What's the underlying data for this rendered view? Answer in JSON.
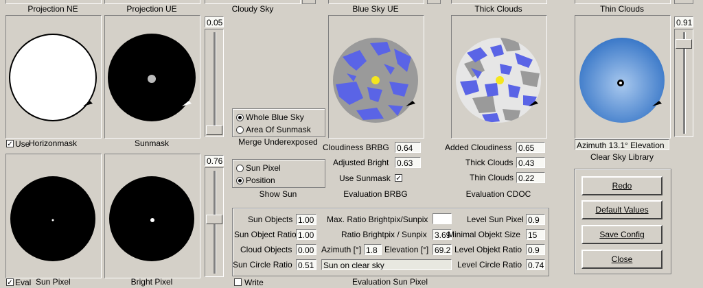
{
  "top_labels": [
    "Projection NE",
    "Projection UE",
    "Cloudy Sky",
    "Blue Sky UE",
    "Thick Clouds",
    "Thin Clouds"
  ],
  "captions": {
    "horizonmask": "Horizonmask",
    "sunmask": "Sunmask",
    "sun_pixel": "Sun Pixel",
    "bright_pixel": "Bright Pixel",
    "clear_sky_library": "Clear Sky Library",
    "azimuth_readout": "Azimuth 13.1°  Elevation"
  },
  "checks": {
    "use": {
      "label": "Use",
      "checked": true
    },
    "eval": {
      "label": "Eval",
      "checked": true
    },
    "write": {
      "label": "Write",
      "checked": false
    },
    "use_sunmask": {
      "label": "Use Sunmask",
      "checked": true
    }
  },
  "sliders": {
    "top_value": "0.05",
    "mid_value": "0.76",
    "right_value": "0.91"
  },
  "merge_group": {
    "options": [
      "Whole Blue Sky",
      "Area Of Sunmask"
    ],
    "selected": "Whole Blue Sky",
    "caption": "Merge Underexposed"
  },
  "sun_group": {
    "options": [
      "Sun Pixel",
      "Position"
    ],
    "selected": "Position",
    "caption": "Show Sun"
  },
  "eval_brbg": {
    "caption": "Evaluation BRBG",
    "fields": [
      {
        "label": "Cloudiness BRBG",
        "value": "0.64"
      },
      {
        "label": "Adjusted Bright",
        "value": "0.63"
      }
    ]
  },
  "eval_cdoc": {
    "caption": "Evaluation CDOC",
    "fields": [
      {
        "label": "Added Cloudiness",
        "value": "0.65"
      },
      {
        "label": "Thick Clouds",
        "value": "0.43"
      },
      {
        "label": "Thin Clouds",
        "value": "0.22"
      }
    ]
  },
  "buttons": [
    "Redo",
    "Default Values",
    "Save Config",
    "Close"
  ],
  "eval_sun": {
    "caption": "Evaluation Sun Pixel",
    "sun_objects": {
      "label": "Sun Objects",
      "value": "1.00"
    },
    "sun_object_ratio": {
      "label": "Sun Object Ratio",
      "value": "1.00"
    },
    "cloud_objects": {
      "label": "Cloud Objects",
      "value": "0.00"
    },
    "sun_circle_ratio": {
      "label": "Sun Circle Ratio",
      "value": "0.51"
    },
    "max_ratio": {
      "label": "Max. Ratio Brightpix/Sunpix",
      "value": ""
    },
    "ratio_bright": {
      "label": "Ratio Brightpix / Sunpix",
      "value": "3.69"
    },
    "azimuth": {
      "label": "Azimuth [°]",
      "value": "1.8"
    },
    "elevation": {
      "label": "Elevation [°]",
      "value": "69.2"
    },
    "status": "Sun on clear sky",
    "level_sun_pixel": {
      "label": "Level Sun Pixel",
      "value": "0.9"
    },
    "minimal_objekt_size": {
      "label": "Minimal Objekt Size",
      "value": "15"
    },
    "level_objekt_ratio": {
      "label": "Level Objekt Ratio",
      "value": "0.9"
    },
    "level_circle_ratio": {
      "label": "Level Circle Ratio",
      "value": "0.74"
    }
  },
  "colors": {
    "background": "#d4d0c8",
    "blue_sky": "#5a64e6",
    "sun": "#f5e61e",
    "gray_sky": "#9a9a9a"
  }
}
